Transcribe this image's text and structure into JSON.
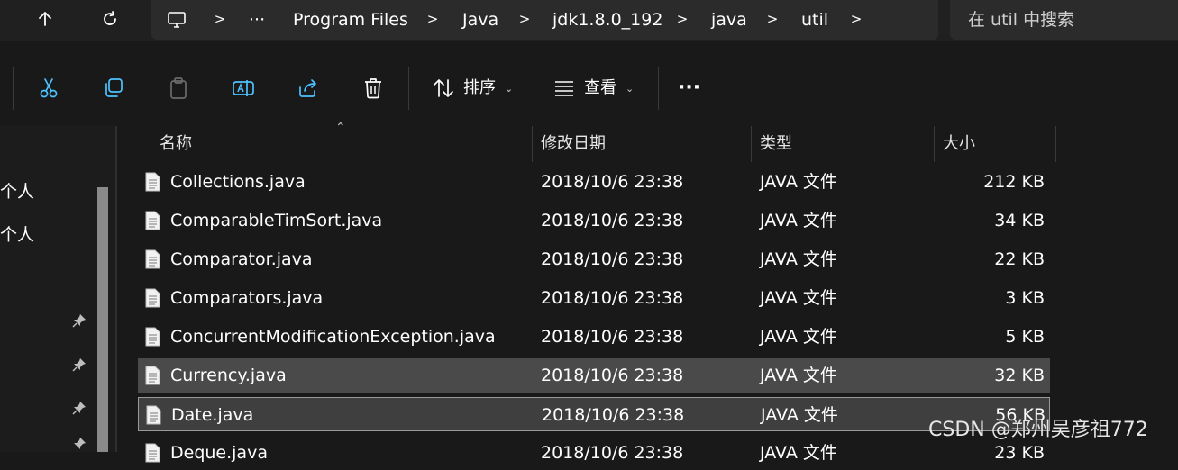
{
  "nav": {
    "up_icon": "arrow-up-icon",
    "refresh_icon": "refresh-icon"
  },
  "address": {
    "pc_icon": "this-pc-icon",
    "ellipsis": "···",
    "breadcrumbs": [
      "Program Files",
      "Java",
      "jdk1.8.0_192",
      "java",
      "util"
    ]
  },
  "search": {
    "placeholder": "在 util 中搜索"
  },
  "toolbar": {
    "cut_icon": "cut-icon",
    "copy_icon": "copy-icon",
    "paste_icon": "paste-icon",
    "rename_icon": "rename-icon",
    "share_icon": "share-icon",
    "delete_icon": "delete-icon",
    "sort_label": "排序",
    "view_label": "查看",
    "more_label": "···"
  },
  "sidebar": {
    "items": [
      "个人",
      "个人"
    ]
  },
  "columns": {
    "name": "名称",
    "modified": "修改日期",
    "type": "类型",
    "size": "大小"
  },
  "files": [
    {
      "name": "Collections.java",
      "modified": "2018/10/6 23:38",
      "type": "JAVA 文件",
      "size": "212 KB"
    },
    {
      "name": "ComparableTimSort.java",
      "modified": "2018/10/6 23:38",
      "type": "JAVA 文件",
      "size": "34 KB"
    },
    {
      "name": "Comparator.java",
      "modified": "2018/10/6 23:38",
      "type": "JAVA 文件",
      "size": "22 KB"
    },
    {
      "name": "Comparators.java",
      "modified": "2018/10/6 23:38",
      "type": "JAVA 文件",
      "size": "3 KB"
    },
    {
      "name": "ConcurrentModificationException.java",
      "modified": "2018/10/6 23:38",
      "type": "JAVA 文件",
      "size": "5 KB"
    },
    {
      "name": "Currency.java",
      "modified": "2018/10/6 23:38",
      "type": "JAVA 文件",
      "size": "32 KB"
    },
    {
      "name": "Date.java",
      "modified": "2018/10/6 23:38",
      "type": "JAVA 文件",
      "size": "56 KB"
    },
    {
      "name": "Deque.java",
      "modified": "2018/10/6 23:38",
      "type": "JAVA 文件",
      "size": "23 KB"
    }
  ],
  "watermark": "CSDN @郑州吴彦祖772",
  "colors": {
    "background": "#191919",
    "bar": "#2b2b2b",
    "selected": "#4a4a4a",
    "accent": "#4cc2ff"
  }
}
